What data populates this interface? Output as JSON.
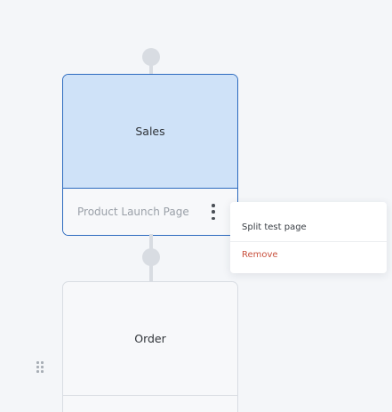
{
  "flow": {
    "sales_node": {
      "title": "Sales",
      "page_name": "Product Launch Page"
    },
    "order_node": {
      "title": "Order"
    }
  },
  "context_menu": {
    "split_test_label": "Split test page",
    "remove_label": "Remove"
  },
  "colors": {
    "canvas_background": "#f4f6f9",
    "selected_node_fill": "#cfe2f8",
    "selected_node_border": "#2d6bbf",
    "connector": "#d8dce2",
    "remove_text": "#c8503d"
  },
  "icons": {
    "node_menu": "more-vertical-icon",
    "drag": "drag-handle-icon"
  }
}
